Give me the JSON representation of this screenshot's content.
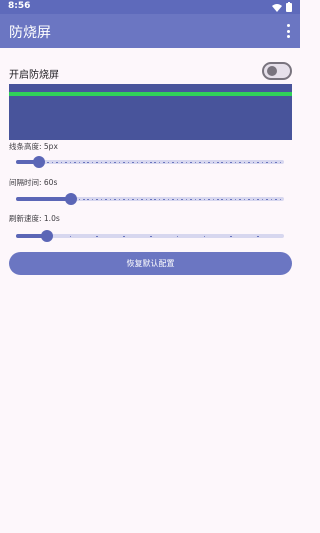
{
  "status_bar": {
    "time": "8:56",
    "icons": [
      "wifi-icon",
      "battery-icon"
    ]
  },
  "app_bar": {
    "title": "防烧屏",
    "menu_icon": "more-vertical-icon"
  },
  "enable": {
    "label": "开启防烧屏",
    "checked": false
  },
  "preview": {
    "line_color": "#30d158",
    "background": "#48549b"
  },
  "sliders": [
    {
      "label": "线条高度: 5px",
      "fraction": 0.085,
      "ticks": 60
    },
    {
      "label": "间隔时间: 60s",
      "fraction": 0.205,
      "ticks": 60
    },
    {
      "label": "刷新速度: 1.0s",
      "fraction": 0.115,
      "ticks": 10
    }
  ],
  "reset_button": {
    "label": "恢复默认配置"
  },
  "colors": {
    "accent": "#6b76c2",
    "status_bar": "#5e6abb",
    "background": "#fdf7fb"
  }
}
